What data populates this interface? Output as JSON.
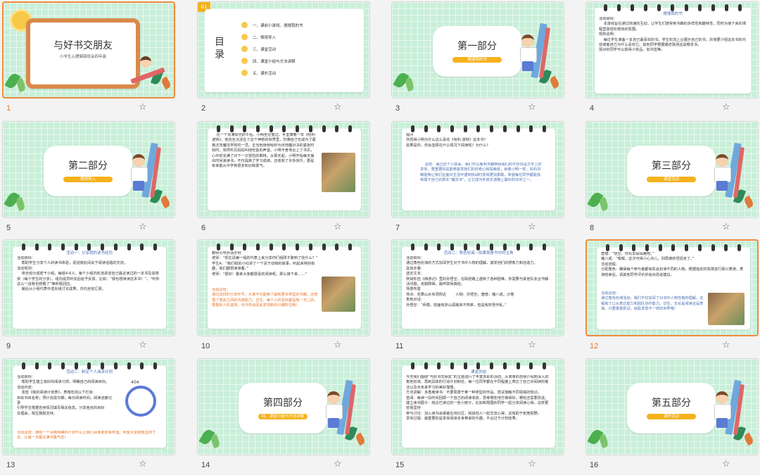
{
  "slides": [
    {
      "num": "1",
      "selected": true,
      "title": "与好书交朋友",
      "subtitle": "小学生心理健康班会四年级"
    },
    {
      "num": "2",
      "badge": "01",
      "toc_title": "目录",
      "items": [
        "一、课前小游戏、搜搜我的书",
        "二、情境导入",
        "三、课堂活动",
        "四、课堂小结与方法讲解",
        "五、课外活动"
      ]
    },
    {
      "num": "3",
      "section": "第一部分",
      "pill": "搜搜我的书"
    },
    {
      "num": "4",
      "header": "搜搜我的书",
      "body": "活动目标：\n    本游戏旨在通过快速的互动，让学生们感受到书籍的多样性和趣味性，同时为接下来的课程营造轻松愉快的氛围。\n规则说明：\n    每位学生准备一本自己最喜欢的书。学生轮流上台展示自己的书，并简要介绍这本书的内容或者自己为什么喜欢它。其他同学根据描述猜测这是哪本书。\n猜对的同学可以获得小奖品，如书签等。"
    },
    {
      "num": "5",
      "section": "第二部分",
      "pill": "情境导入"
    },
    {
      "num": "6",
      "body": "    在一个充满阳光的午后，小明坐在窗边，手里捧着一本《哈利·波特》。他完全沉浸在了这个神奇的世界里，仿佛自己也成为了霍格沃茨魔法学校的一员。正当他读到哈利与伏地魔对决的紧张时刻时，突然听见妈妈叫他吃饭的声音。小明不舍地合上了书页，心中却充满了对下一次冒险的期待。从那天起，小明开始每天抽出时间来读书，不仅提高了学习成绩，还收获了许多快乐，更是有幸能从中学到很多知识和勇气。"
    },
    {
      "num": "7",
      "body": "提问\n你觉得小明为什么这么喜欢《哈利·波特》这本书？\n如果是你，你会选择在什么情况下阅读呢？为什么？",
      "summary": "    总结：通过这个小故事，我们可以看到书籍带给我们的不仅仅是文字上的享受，更重要的是能够激发我们的好奇心和探索欲，就像小明一样，好的书籍能够让我们在面对生活中遇到挑战时变得更加勇敢。希望每位同学都能找到属于自己的那本“魔法书”，让它成为你成长道路上最好的伙伴之一。"
    },
    {
      "num": "8",
      "section": "第三部分",
      "pill": "课堂活动"
    },
    {
      "num": "9",
      "header": "活动一：分享我的读书经历",
      "body": "活动目标：\n    帮助学生分享个人的读书体验，促进彼此间关于阅读话题的交流。\n活动规则：\n    将全班分成若干小组，每组4-6人。每个小组内轮流讲述自己最近读过的一本书及其感受（每个学生的分享）。组内成员听完后给予反馈，比如：“我也想读读这本书！”、“听你这么一说我也想看了”等积极回应。\n    最后从小组代表中选出组讨论成果，并向全班汇报。"
    },
    {
      "num": "10",
      "body": "教师引导对话示例\n老师：“现在请第一组的代表上来分享你们组刚才聊到了些什么？”\n学生A：“我们组的小红讲了一个关于动物的故事，听起来特别有趣，我们都想读读看。”\n老师：“很好！看来大家都很喜欢阅读呢。那么接下来……”",
      "summary": "活动总结：\n通过这样的分享环节，大家不仅能够了解到更多类型的书籍，还增强了彼此之间的沟通能力。记住，每个人的喜好都是独一无二的，尊重别人的选择，也许你会因此发现新的兴趣所在哦！"
    },
    {
      "num": "11",
      "header": "活动二：角色扮演—如果我是书中的主角",
      "body": "活动目标：\n通过角色扮演的方式加深学生对于书中人物的理解，激发他们的想象力和创造力。\n具体步骤：\n选定文本：\n例如你选《西游记》里的孙悟空，在取经路上遇到了各种困难。你需要与其他队友合作解决问题。克服障碍，最终取得真经。\n场景布置\n地点：花果山水帘洞附近        人物：孙悟空，唐僧，猪八戒，沙僧\n角色对话：\n孙悟空：“师傅，前面有妖山恶路来不简单，但是有妖怪作乱。”"
    },
    {
      "num": "12",
      "selected": true,
      "body": "唐僧：“悟空，你先去探探路吧。”\n猪八戒：“嘿嘿，这次可得小心点儿，别再被妖怪捉走了。”\n活动流程：\n分配角色：确保每个参与者都有机会扮演不同的人物。根据指定的情境进行即兴表演，表演结束后，请其他同学评价并给出改进建议。",
      "summary": "活动总结：\n通过角色扮演活动，我们不仅加深了对书中人物性格的理解，还锻炼了口头表达能力和团队协作能力。记住，无论是阅读还是表演，只要勇敢尝试，就能发现不一样的世界哦！"
    },
    {
      "num": "13",
      "header": "活动三：制定个人阅读计划",
      "body": "活动目标：\n    帮助学生建立良好的阅读习惯，明确自己的阅读目标。\n活动内容：\n    发放《我的阅读计划表》，表格包括以下栏目：\n目标书目名称；预计完成日期；每日阅读时间；阅读进度记录\n引导学生根据自身情况填写相关信息。分享各自的目标\n及理由，相互鼓励支持。",
      "summary": "活动总结：拥有一个清晰明确的计划可以让我们阅读更加有条理。希望大家能够坚持下去，让每一天都充满书香气息！",
      "clock": "404"
    },
    {
      "num": "14",
      "section": "第四部分",
      "pill": "四、课堂小结与方法讲解"
    },
    {
      "num": "15",
      "header": "课堂总结",
      "body": "今天我们围绕“与好书交朋友”的主题进行了丰富多彩的活动，从简单的自我介绍到深入的角色扮演，再到具体的行动计划制定，每一位同学都在不同程度上表达了自己对阅读的看法以及对未来学习的美好憧憬。\n方法讲解：多角度读书：不要局限于某一种类型的作品，尝试接触不同领域的知识。\n查阅：每读一段时间回顾一下自己的阅读收获，思考哪些地方做得好，哪些还需要改进。\n建立读书圈子：结合已读过的一些小册子，比如和周围的同学一起分享阅读心得，这样更容易坚持\n参与讨论：加入读书会或者在线社区，和其他人一起交流心得，这有助于拓宽视野。\n享受过程：最重要的是享受阅读本身带来的乐趣，不必过于计较结果。"
    },
    {
      "num": "16",
      "section": "第五部分",
      "pill": "课外活动"
    }
  ],
  "colors": {
    "accent": "#f08a3c",
    "pill": "#f5b21d",
    "text_blue": "#4a6fb5",
    "grid_bg": "#c9efd9"
  },
  "icons": {
    "favorite": "star-outline-icon"
  }
}
